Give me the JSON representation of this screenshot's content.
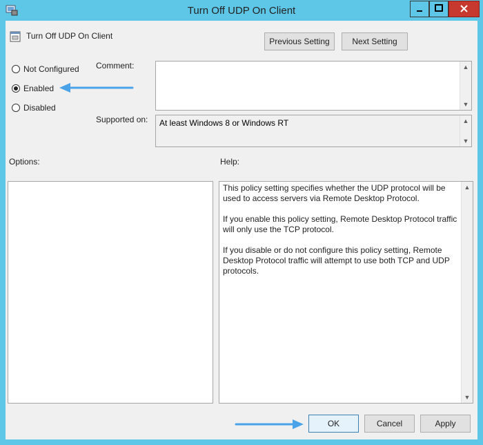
{
  "window": {
    "title": "Turn Off UDP On Client",
    "accent": "#5ec7e8",
    "close_color": "#c7392f"
  },
  "header": {
    "setting_name": "Turn Off UDP On Client",
    "previous_label": "Previous Setting",
    "next_label": "Next Setting"
  },
  "state": {
    "options": [
      {
        "label": "Not Configured",
        "selected": false
      },
      {
        "label": "Enabled",
        "selected": true
      },
      {
        "label": "Disabled",
        "selected": false
      }
    ]
  },
  "comment": {
    "label": "Comment:",
    "value": ""
  },
  "supported": {
    "label": "Supported on:",
    "value": "At least Windows 8 or Windows RT"
  },
  "options_pane": {
    "label": "Options:"
  },
  "help_pane": {
    "label": "Help:",
    "paragraphs": [
      "This policy setting specifies whether the UDP protocol will be used to access servers via Remote Desktop Protocol.",
      "If you enable this policy setting, Remote Desktop Protocol traffic will only use the TCP protocol.",
      "If you disable or do not configure this policy setting, Remote Desktop Protocol traffic will attempt to use both TCP and UDP protocols."
    ]
  },
  "footer": {
    "ok_label": "OK",
    "cancel_label": "Cancel",
    "apply_label": "Apply"
  },
  "annotations": {
    "arrow_color": "#4aa3e8"
  }
}
